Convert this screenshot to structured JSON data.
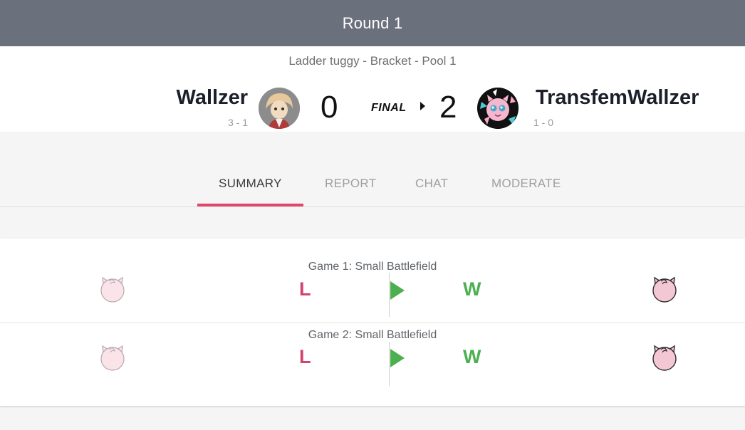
{
  "header": {
    "title": "Round 1"
  },
  "match": {
    "subtitle": "Ladder tuggy - Bracket - Pool 1",
    "status": "FINAL",
    "player1": {
      "name": "Wallzer",
      "record": "3 - 1",
      "score": "0"
    },
    "player2": {
      "name": "TransfemWallzer",
      "record": "1 - 0",
      "score": "2"
    }
  },
  "tabs": [
    {
      "label": "SUMMARY",
      "active": true
    },
    {
      "label": "REPORT",
      "active": false
    },
    {
      "label": "CHAT",
      "active": false
    },
    {
      "label": "MODERATE",
      "active": false
    }
  ],
  "games": [
    {
      "title": "Game 1: Small Battlefield",
      "left_result": "L",
      "right_result": "W",
      "left_character": "jigglypuff-icon",
      "right_character": "jigglypuff-icon"
    },
    {
      "title": "Game 2: Small Battlefield",
      "left_result": "L",
      "right_result": "W",
      "left_character": "jigglypuff-icon",
      "right_character": "jigglypuff-icon"
    }
  ],
  "colors": {
    "header_bg": "#6b717c",
    "accent": "#e0476a",
    "win": "#4caf50",
    "loss": "#d0456d"
  }
}
